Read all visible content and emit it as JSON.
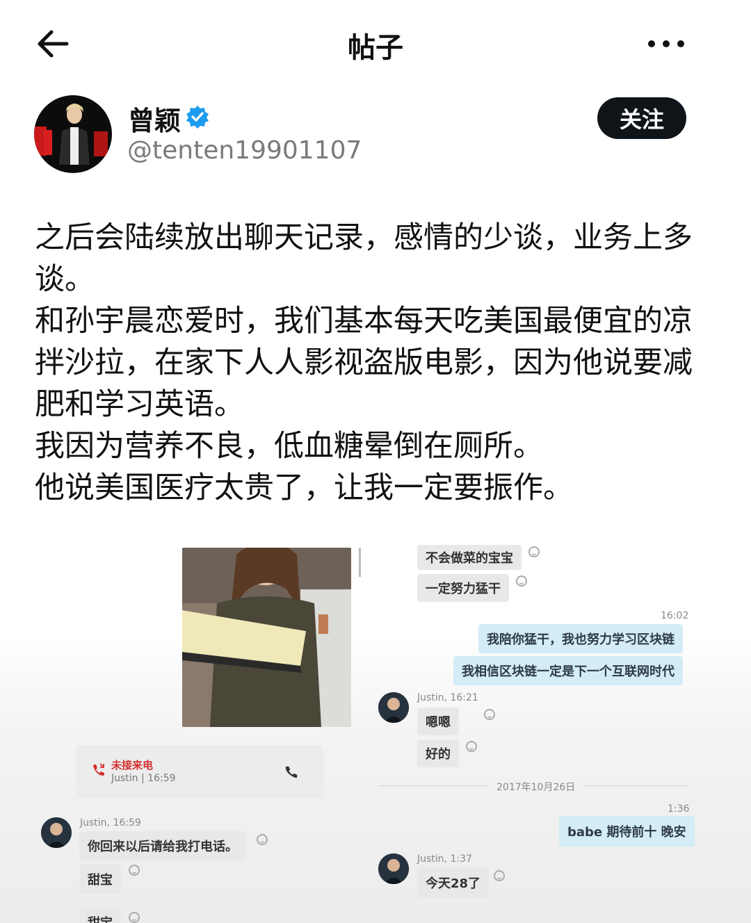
{
  "header": {
    "title": "帖子"
  },
  "author": {
    "name": "曾颖",
    "handle": "@tenten19901107",
    "follow_label": "关注"
  },
  "post": {
    "paragraphs": [
      "之后会陆续放出聊天记录，感情的少谈，业务上多谈。",
      "和孙宇晨恋爱时，我们基本每天吃美国最便宜的凉拌沙拉，在家下人人影视盗版电影，因为他说要减肥和学习英语。",
      "我因为营养不良，低血糖晕倒在厕所。",
      "他说美国医疗太贵了，让我一定要振作。"
    ]
  },
  "chat": {
    "msg1": "不会做菜的宝宝",
    "msg2": "一定努力猛干",
    "time1": "16:02",
    "msg3": "我陪你猛干，我也努力学习区块链",
    "msg4": "我相信区块链一定是下一个互联网时代",
    "sender1": "Justin, 16:21",
    "msg5": "嗯嗯",
    "msg6": "好的",
    "missed_call": "未接来电",
    "missed_sub": "Justin | 16:59",
    "sender2": "Justin, 16:59",
    "msg7": "你回来以后请给我打电话。",
    "msg8": "甜宝",
    "msg9": "甜宝",
    "date": "2017年10月26日",
    "time2": "1:36",
    "msg10": "babe 期待前十 晚安",
    "sender3": "Justin, 1:37",
    "msg11": "今天28了"
  },
  "colors": {
    "follow_bg": "#0f1419",
    "verified": "#1d9bf0",
    "right_bubble": "#d3ecf6",
    "missed_red": "#d23030"
  },
  "icons": [
    "back-arrow-icon",
    "more-icon",
    "verified-badge-icon",
    "missed-call-icon",
    "phone-icon",
    "smile-icon"
  ]
}
